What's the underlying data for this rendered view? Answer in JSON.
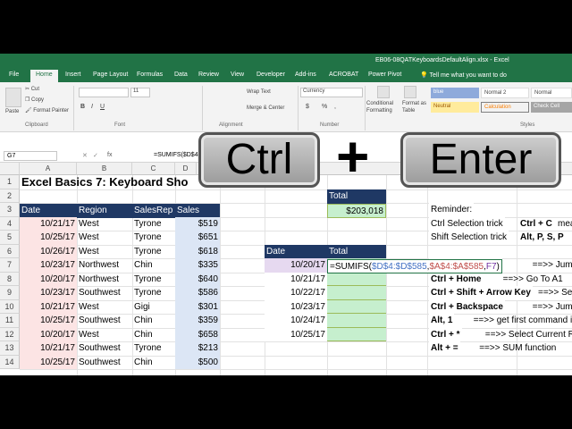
{
  "window": {
    "title": "EB06-08QATKeyboardsDefaultAlign.xlsx - Excel"
  },
  "tabs": [
    "File",
    "Home",
    "Insert",
    "Page Layout",
    "Formulas",
    "Data",
    "Review",
    "View",
    "Developer",
    "Add-ins",
    "ACROBAT",
    "Power Pivot"
  ],
  "tell_me": "Tell me what you want to do",
  "ribbon": {
    "cut": "Cut",
    "copy": "Copy",
    "format_painter": "Format Painter",
    "paste": "Paste",
    "font_size": "11",
    "wrap_text": "Wrap Text",
    "merge_center": "Merge & Center",
    "number_format": "Currency",
    "dollar": "$",
    "percent": "%",
    "comma": ",",
    "conditional_formatting": "Conditional Formatting",
    "format_as_table": "Format as Table",
    "styles": [
      "blue",
      "Normal 2",
      "Normal",
      "Neutral",
      "Calculation",
      "Check Cell"
    ],
    "groups": [
      "Clipboard",
      "Font",
      "Alignment",
      "Number",
      "Styles"
    ]
  },
  "formula_bar": {
    "name_box": "G7",
    "fx": "fx",
    "formula": "=SUMIFS($D$4:$"
  },
  "overlay": {
    "ctrl": "Ctrl",
    "plus": "+",
    "enter": "Enter"
  },
  "columns": [
    "A",
    "B",
    "C",
    "D"
  ],
  "rows": [
    "1",
    "2",
    "3",
    "4",
    "5",
    "6",
    "7",
    "8",
    "9",
    "10",
    "11",
    "12",
    "13",
    "14"
  ],
  "sheet": {
    "title": "Excel Basics 7: Keyboard Sho",
    "headers": [
      "Date",
      "Region",
      "SalesRep",
      "Sales"
    ],
    "data": [
      [
        "10/21/17",
        "West",
        "Tyrone",
        "$519"
      ],
      [
        "10/25/17",
        "West",
        "Tyrone",
        "$651"
      ],
      [
        "10/26/17",
        "West",
        "Tyrone",
        "$618"
      ],
      [
        "10/23/17",
        "Northwest",
        "Chin",
        "$335"
      ],
      [
        "10/20/17",
        "Northwest",
        "Tyrone",
        "$640"
      ],
      [
        "10/23/17",
        "Southwest",
        "Tyrone",
        "$586"
      ],
      [
        "10/21/17",
        "West",
        "Gigi",
        "$301"
      ],
      [
        "10/25/17",
        "Southwest",
        "Chin",
        "$359"
      ],
      [
        "10/20/17",
        "West",
        "Chin",
        "$658"
      ],
      [
        "10/21/17",
        "Southwest",
        "Tyrone",
        "$213"
      ],
      [
        "10/25/17",
        "Southwest",
        "Chin",
        "$500"
      ]
    ],
    "total_label": "Total",
    "total_value": "$203,018",
    "summary_headers": [
      "Date",
      "Total"
    ],
    "summary_dates": [
      "10/20/17",
      "10/21/17",
      "10/22/17",
      "10/23/17",
      "10/24/17",
      "10/25/17"
    ],
    "formula_parts": [
      "=SUMIFS(",
      "$D$4:$D$585",
      ",",
      "$A$4:$A$585",
      ",",
      "F7",
      ")"
    ]
  },
  "notes": [
    [
      "Reminder:",
      ""
    ],
    [
      "Ctrl Selection trick",
      "Ctrl + C",
      "mea"
    ],
    [
      "Shift Selection trick",
      "Alt, P, S, P"
    ],
    [
      "Ctrl + Arrow Key",
      "==>> Jump to en"
    ],
    [
      "Ctrl + Home",
      "==>> Go To A1"
    ],
    [
      "Ctrl + Shift + Arrow Key",
      "==>> Sele"
    ],
    [
      "Ctrl + Backspace",
      "==>> Jump Back to"
    ],
    [
      "Alt, 1",
      "==>> get first command in"
    ],
    [
      "Ctrl + *",
      "==>> Select Current Regio"
    ],
    [
      "Alt + =",
      "==>> SUM function"
    ]
  ],
  "colors": {
    "excel_green": "#217346",
    "header_navy": "#1f3864",
    "summary_green": "#c6efce",
    "date_pink": "#fce4e4",
    "sales_blue": "#dce6f5"
  }
}
